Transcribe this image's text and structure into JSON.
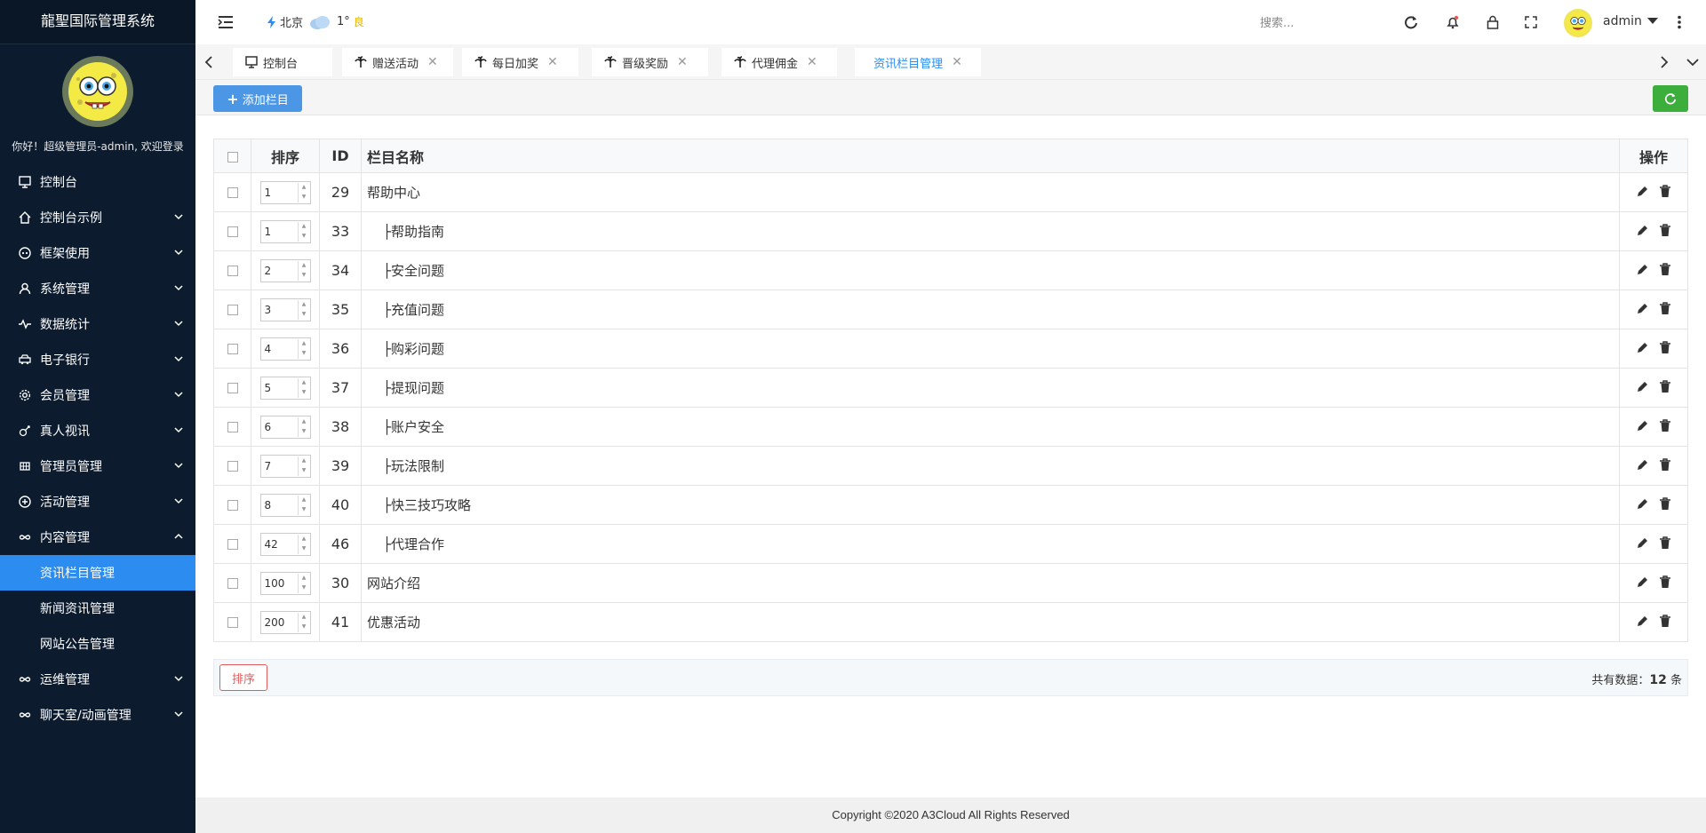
{
  "sidebar": {
    "title": "龍聖国际管理系统",
    "welcome": "你好！超级管理员-admin, 欢迎登录",
    "items": [
      {
        "label": "控制台",
        "icon": "monitor-icon",
        "has_children": false
      },
      {
        "label": "控制台示例",
        "icon": "home-icon",
        "has_children": true
      },
      {
        "label": "框架使用",
        "icon": "grid-circle-icon",
        "has_children": true
      },
      {
        "label": "系统管理",
        "icon": "user-icon",
        "has_children": true
      },
      {
        "label": "数据统计",
        "icon": "pulse-icon",
        "has_children": true
      },
      {
        "label": "电子银行",
        "icon": "car-icon",
        "has_children": true
      },
      {
        "label": "会员管理",
        "icon": "gear-icon",
        "has_children": true
      },
      {
        "label": "真人视讯",
        "icon": "game-icon",
        "has_children": true
      },
      {
        "label": "管理员管理",
        "icon": "table-icon",
        "has_children": true
      },
      {
        "label": "活动管理",
        "icon": "plus-circle-icon",
        "has_children": true
      },
      {
        "label": "内容管理",
        "icon": "infinity-icon",
        "has_children": true,
        "expanded": true
      }
    ],
    "sub_items": [
      {
        "label": "资讯栏目管理",
        "active": true
      },
      {
        "label": "新闻资讯管理",
        "active": false
      },
      {
        "label": "网站公告管理",
        "active": false
      }
    ],
    "items_after": [
      {
        "label": "运维管理",
        "icon": "infinity-icon"
      },
      {
        "label": "聊天室/动画管理",
        "icon": "infinity-icon"
      }
    ]
  },
  "header": {
    "city": "北京",
    "temp": "1°",
    "aqi": "良",
    "search_placeholder": "搜索...",
    "username": "admin"
  },
  "tabs": [
    {
      "label": "控制台",
      "closable": false,
      "active": false
    },
    {
      "label": "赠送活动",
      "closable": true,
      "active": false
    },
    {
      "label": "每日加奖",
      "closable": true,
      "active": false
    },
    {
      "label": "晋级奖励",
      "closable": true,
      "active": false
    },
    {
      "label": "代理佣金",
      "closable": true,
      "active": false
    },
    {
      "label": "资讯栏目管理",
      "closable": true,
      "active": true
    }
  ],
  "toolbar": {
    "add_label": "添加栏目"
  },
  "table": {
    "headers": {
      "sort": "排序",
      "id": "ID",
      "name": "栏目名称",
      "op": "操作"
    },
    "rows": [
      {
        "sort": "1",
        "id": "29",
        "name": "帮助中心",
        "child": false
      },
      {
        "sort": "1",
        "id": "33",
        "name": "├帮助指南",
        "child": true
      },
      {
        "sort": "2",
        "id": "34",
        "name": "├安全问题",
        "child": true
      },
      {
        "sort": "3",
        "id": "35",
        "name": "├充值问题",
        "child": true
      },
      {
        "sort": "4",
        "id": "36",
        "name": "├购彩问题",
        "child": true
      },
      {
        "sort": "5",
        "id": "37",
        "name": "├提现问题",
        "child": true
      },
      {
        "sort": "6",
        "id": "38",
        "name": "├账户安全",
        "child": true
      },
      {
        "sort": "7",
        "id": "39",
        "name": "├玩法限制",
        "child": true
      },
      {
        "sort": "8",
        "id": "40",
        "name": "├快三技巧攻略",
        "child": true
      },
      {
        "sort": "42",
        "id": "46",
        "name": "├代理合作",
        "child": true
      },
      {
        "sort": "100",
        "id": "30",
        "name": "网站介绍",
        "child": false
      },
      {
        "sort": "200",
        "id": "41",
        "name": "优惠活动",
        "child": false
      }
    ]
  },
  "footer_bar": {
    "sort_button": "排序",
    "total_prefix": "共有数据：",
    "total_count": "12",
    "total_suffix": " 条"
  },
  "copyright": "Copyright ©2020 A3Cloud All Rights Reserved",
  "colors": {
    "sidebar_bg": "#0c1b2e",
    "accent": "#2d8cf0",
    "add_btn": "#4b97e6",
    "refresh_btn": "#3cae3c",
    "danger": "#e45b5b"
  }
}
